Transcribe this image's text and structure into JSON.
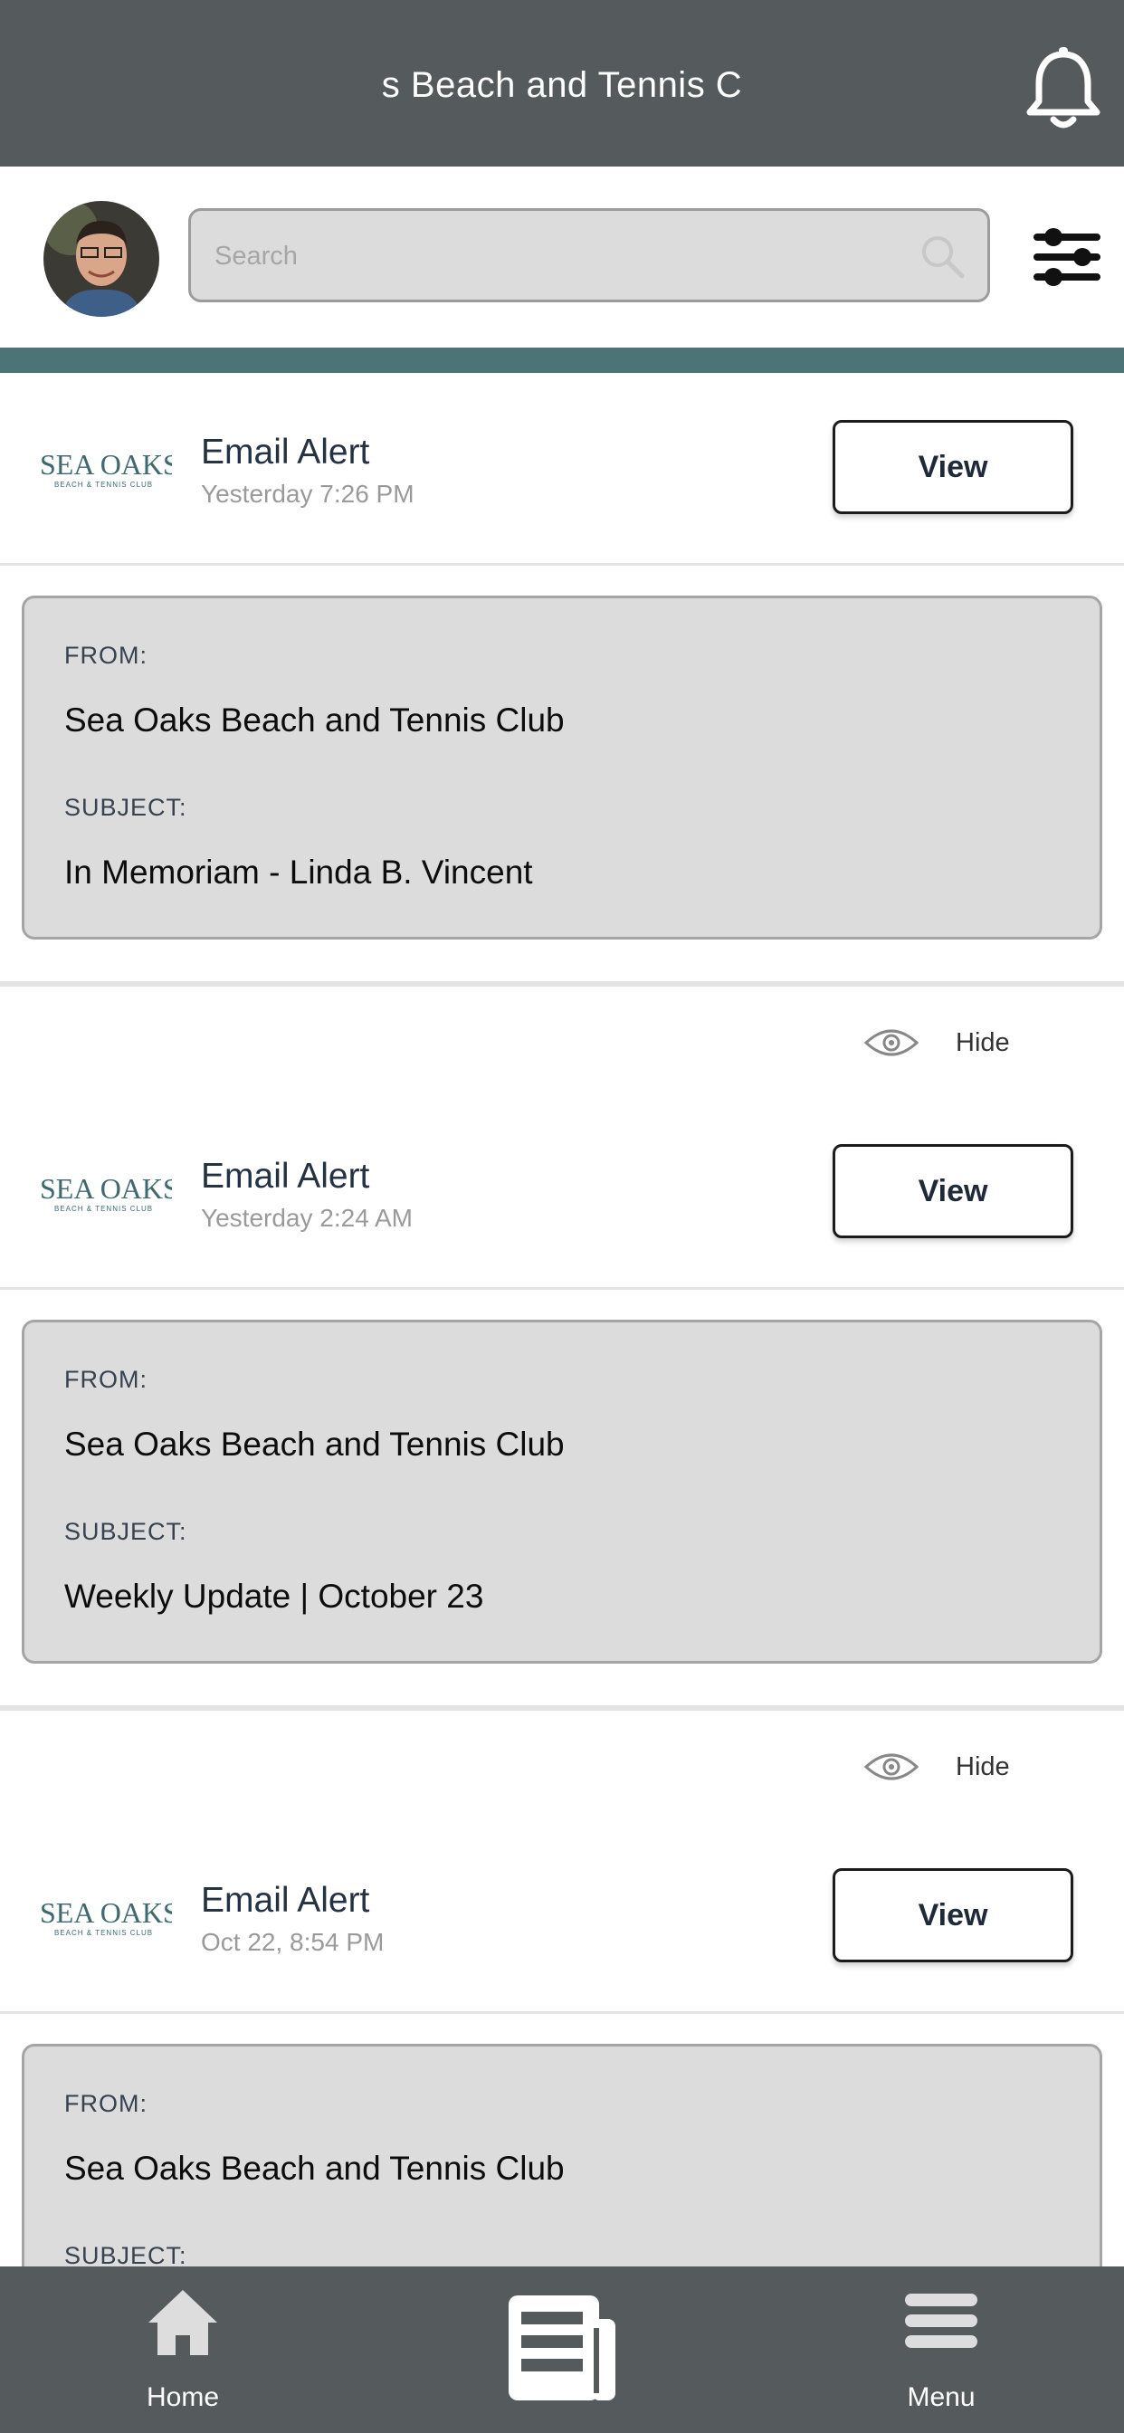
{
  "header": {
    "title": "s Beach and Tennis C",
    "notifications_icon": "bell-icon"
  },
  "search": {
    "placeholder": "Search",
    "icon": "search-icon",
    "filter_icon": "sliders-icon"
  },
  "colors": {
    "header_bg": "#555b5c",
    "accent_strip": "#4c7476",
    "card_bg": "#dcdcdc"
  },
  "feed": [
    {
      "title": "Email Alert",
      "time": "Yesterday 7:26 PM",
      "button": "View",
      "from_label": "FROM:",
      "from": "Sea Oaks Beach and Tennis Club",
      "subject_label": "SUBJECT:",
      "subject": "In Memoriam - Linda B. Vincent",
      "hide_label": "Hide"
    },
    {
      "title": "Email Alert",
      "time": "Yesterday 2:24 AM",
      "button": "View",
      "from_label": "FROM:",
      "from": "Sea Oaks Beach and Tennis Club",
      "subject_label": "SUBJECT:",
      "subject": "Weekly Update | October 23",
      "hide_label": "Hide"
    },
    {
      "title": "Email Alert",
      "time": "Oct 22, 8:54 PM",
      "button": "View",
      "from_label": "FROM:",
      "from": "Sea Oaks Beach and Tennis Club",
      "subject_label": "SUBJECT:"
    }
  ],
  "logo": {
    "main": "SEA OAKS",
    "sub": "BEACH & TENNIS CLUB"
  },
  "bottom_nav": {
    "home": "Home",
    "menu": "Menu",
    "center_icon": "newspaper-icon"
  }
}
